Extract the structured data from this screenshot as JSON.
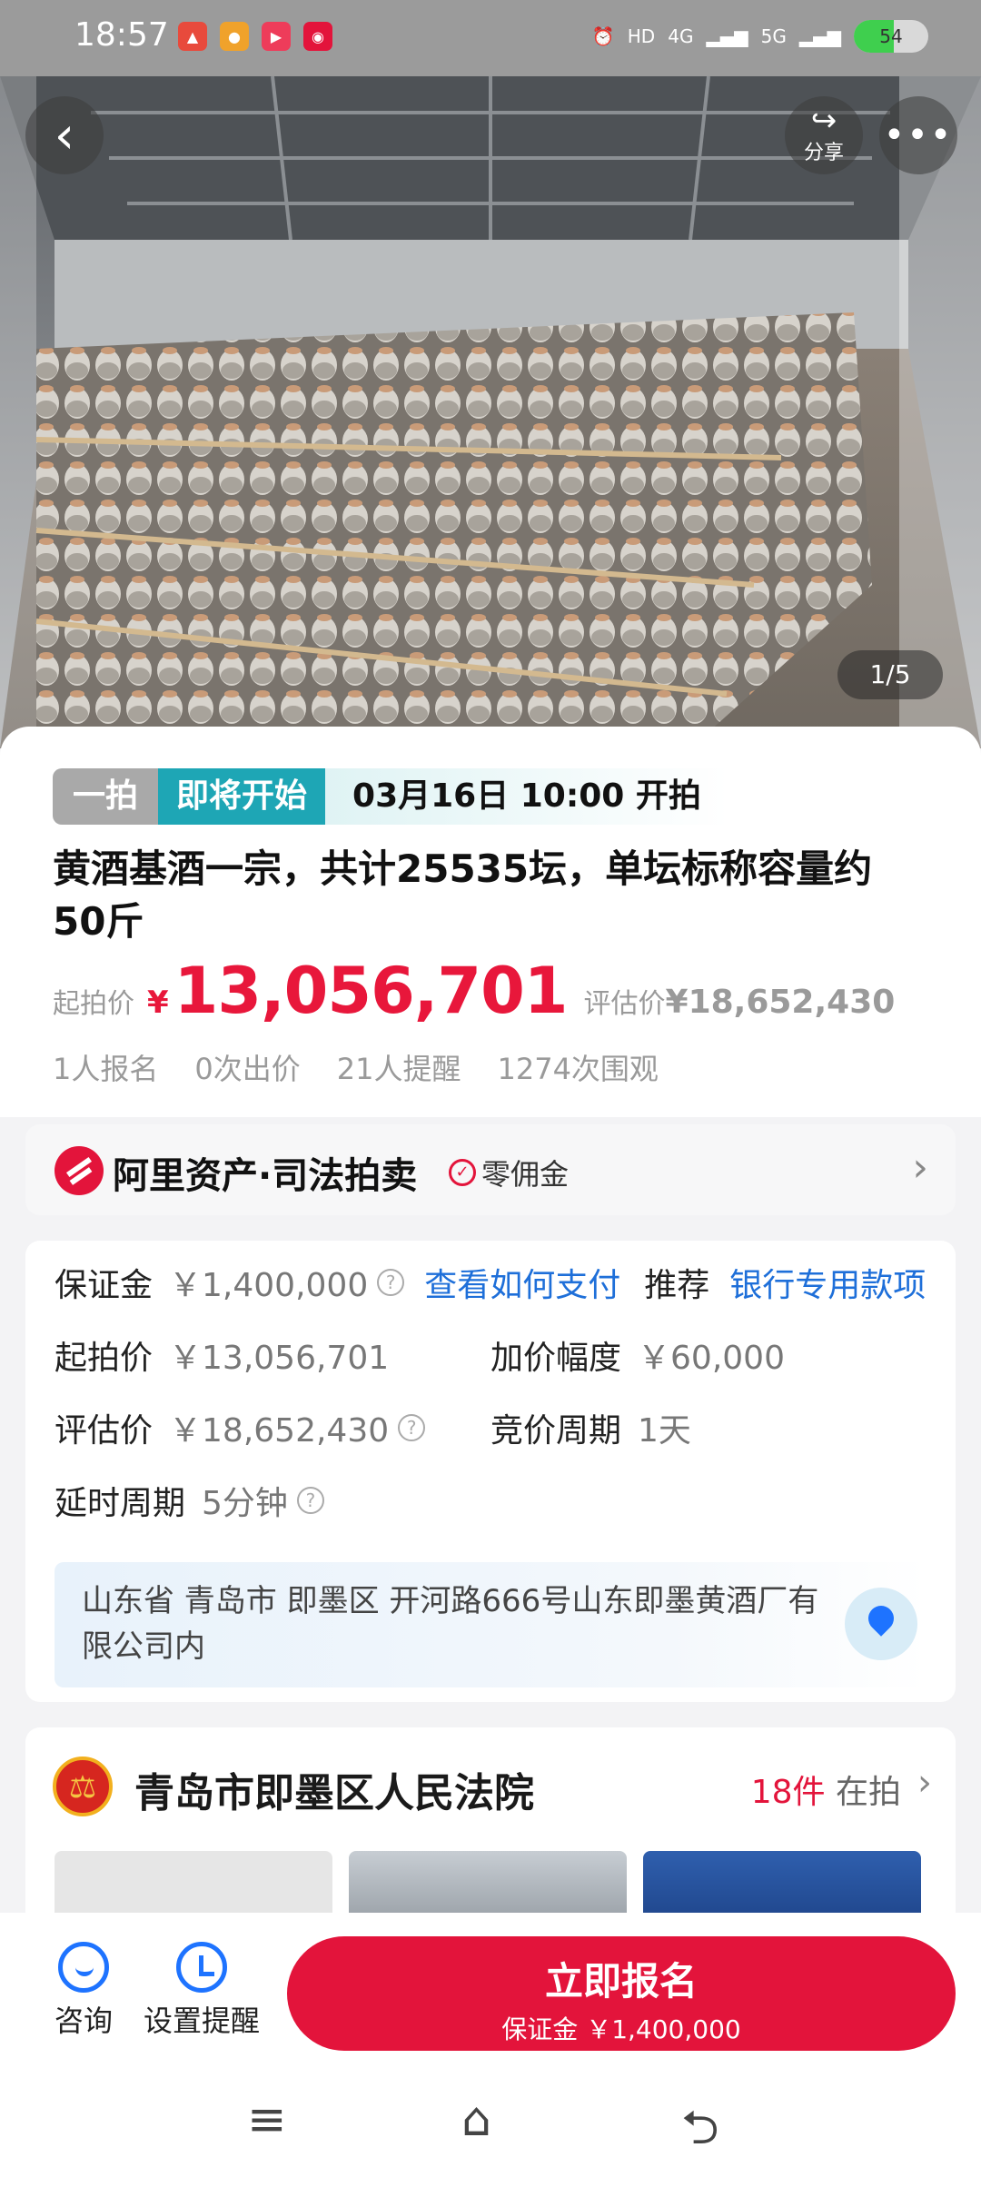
{
  "status_bar": {
    "time": "18:57",
    "network": "4G",
    "network2": "5G",
    "hd": "HD",
    "battery": "54",
    "battery_level": 0.54
  },
  "hero": {
    "share_label": "分享",
    "image_counter": "1/5"
  },
  "listing": {
    "tag_type": "一拍",
    "tag_status": "即将开始",
    "start_time": "03月16日 10:00 开拍",
    "title": "黄酒基酒一宗，共计25535坛，单坛标称容量约50斤",
    "start_price_label": "起拍价",
    "currency": "¥",
    "start_price": "13,056,701",
    "estimate_label": "评估价",
    "estimate_price": "¥18,652,430",
    "stats": [
      "1人报名",
      "0次出价",
      "21人提醒",
      "1274次围观"
    ]
  },
  "brand": {
    "name": "阿里资产·司法拍卖",
    "badge": "零佣金"
  },
  "details": {
    "deposit_label": "保证金",
    "deposit_value": "￥1,400,000",
    "how_to_pay": "查看如何支付",
    "recommend_label": "推荐",
    "recommend_value": "银行专用款项",
    "start_label": "起拍价",
    "start_value": "￥13,056,701",
    "increment_label": "加价幅度",
    "increment_value": "￥60,000",
    "estimate_label": "评估价",
    "estimate_value": "￥18,652,430",
    "cycle_label": "竞价周期",
    "cycle_value": "1天",
    "delay_label": "延时周期",
    "delay_value": "5分钟",
    "address": "山东省 青岛市 即墨区 开河路666号山东即墨黄酒厂有限公司内"
  },
  "court": {
    "name": "青岛市即墨区人民法院",
    "count": "18件",
    "count_suffix": "在拍"
  },
  "actions": {
    "consult": "咨询",
    "reminder": "设置提醒",
    "cta_main": "立即报名",
    "cta_sub": "保证金 ￥1,400,000"
  },
  "colors": {
    "accent": "#e3143b",
    "teal": "#1ea6b5",
    "link": "#1e6fd9"
  },
  "icons": {
    "back": "chevron-left-icon",
    "share": "share-icon",
    "more": "more-dots-icon",
    "question": "question-circle-icon",
    "location": "map-pin-icon",
    "consult": "headset-icon",
    "reminder": "alarm-clock-icon",
    "menu": "menu-icon",
    "home": "home-icon",
    "back_nav": "back-icon"
  }
}
